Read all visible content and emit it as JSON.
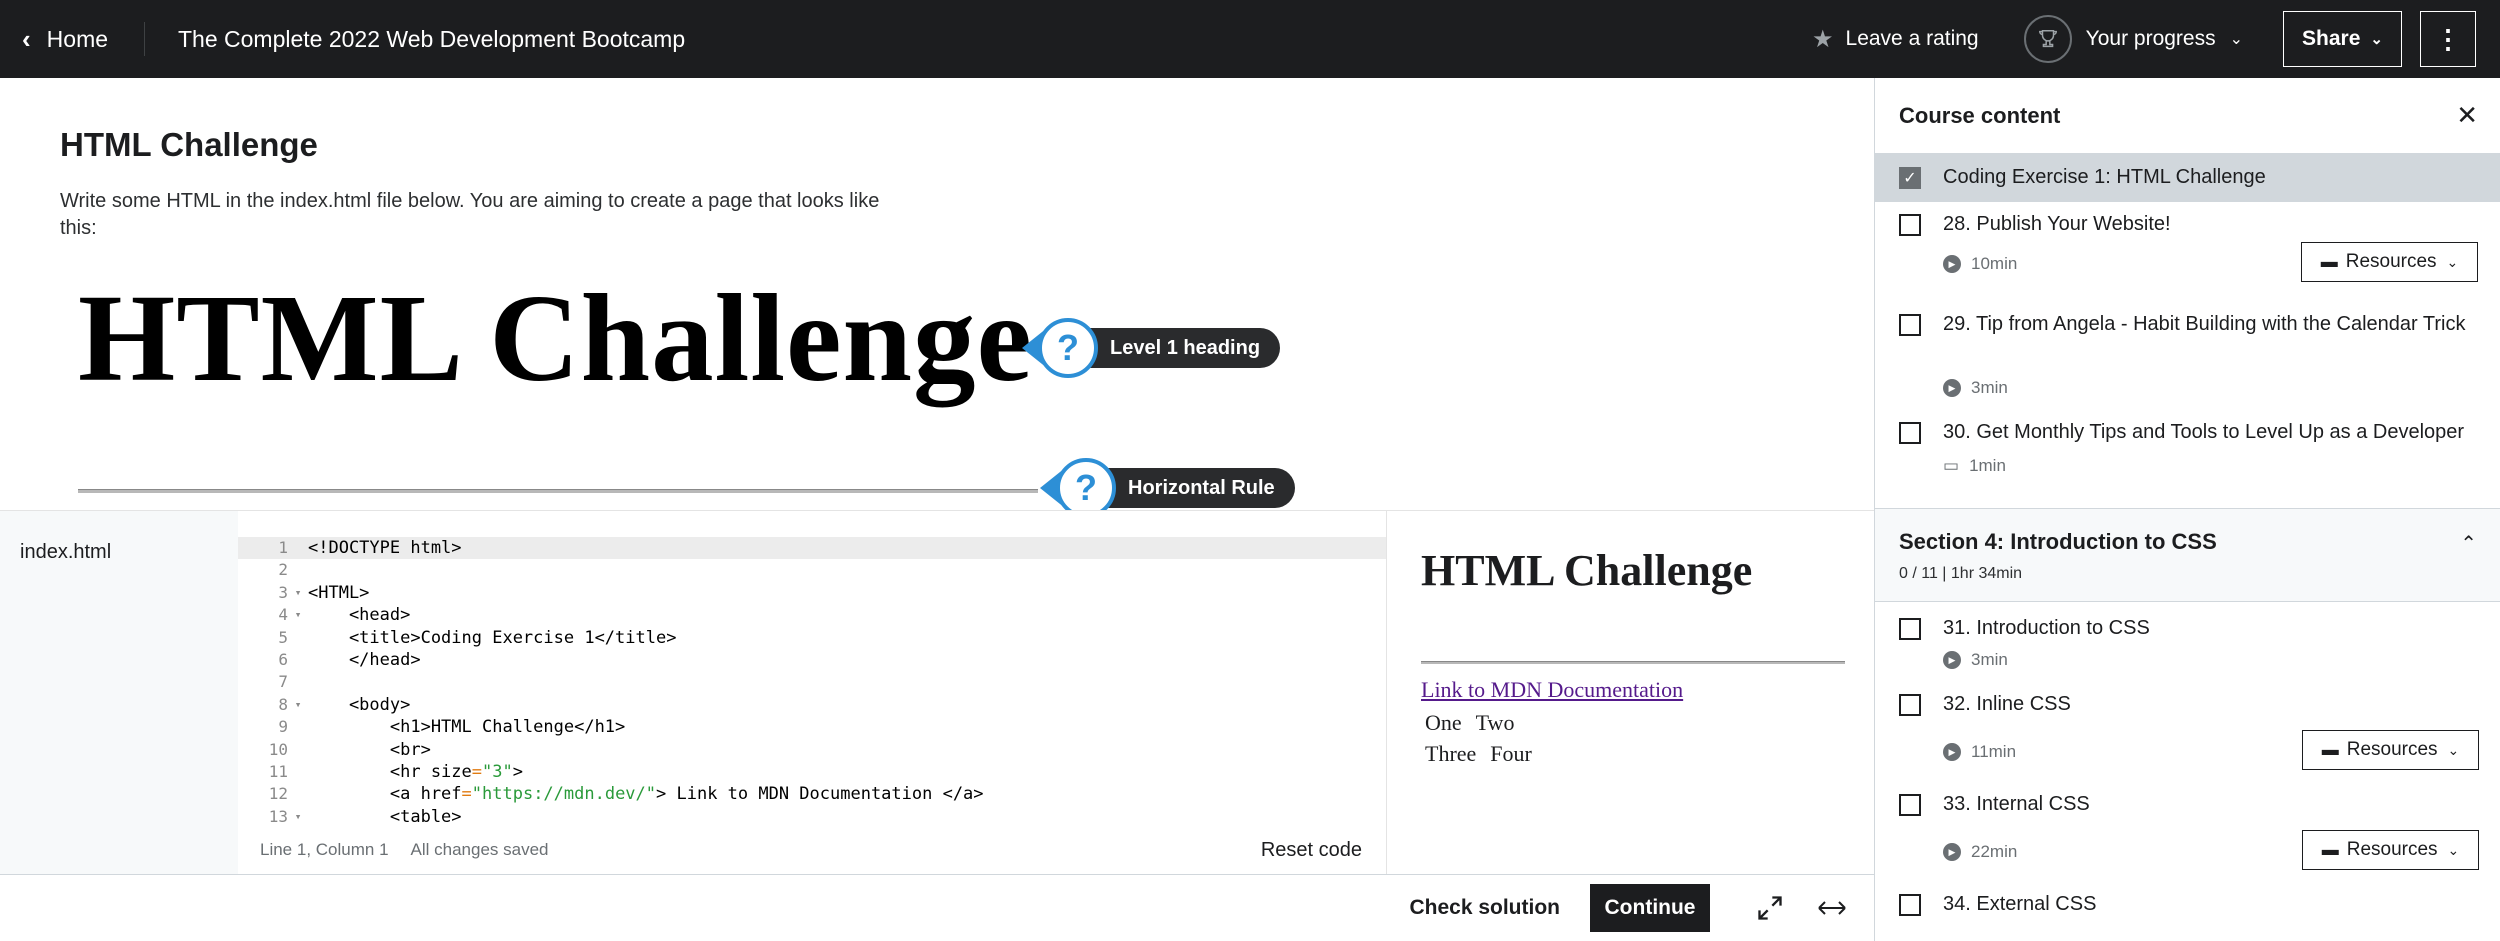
{
  "topbar": {
    "home_label": "Home",
    "course_title": "The Complete 2022 Web Development Bootcamp",
    "rating_label": "Leave a rating",
    "progress_label": "Your progress",
    "share_label": "Share"
  },
  "challenge": {
    "title": "HTML Challenge",
    "description": "Write some HTML in the index.html file below. You are aiming to create a page that looks like this:",
    "example_h1": "HTML Challenge",
    "callout_h1": "Level 1 heading",
    "callout_hr": "Horizontal Rule"
  },
  "editor": {
    "file_name": "index.html",
    "lines": [
      {
        "n": "1",
        "fold": "",
        "code": "<!DOCTYPE html>"
      },
      {
        "n": "2",
        "fold": "",
        "code": ""
      },
      {
        "n": "3",
        "fold": "▾",
        "code": "<HTML>"
      },
      {
        "n": "4",
        "fold": "▾",
        "code": "    <head>"
      },
      {
        "n": "5",
        "fold": "",
        "code": "    <title>Coding Exercise 1</title>"
      },
      {
        "n": "6",
        "fold": "",
        "code": "    </head>"
      },
      {
        "n": "7",
        "fold": "",
        "code": ""
      },
      {
        "n": "8",
        "fold": "▾",
        "code": "    <body>"
      },
      {
        "n": "9",
        "fold": "",
        "code": "        <h1>HTML Challenge</h1>"
      },
      {
        "n": "10",
        "fold": "",
        "code": "        <br>"
      },
      {
        "n": "11",
        "fold": "",
        "code": "        <hr size=\"3\">"
      },
      {
        "n": "12",
        "fold": "",
        "code": "        <a href=\"https://mdn.dev/\"> Link to MDN Documentation </a>"
      },
      {
        "n": "13",
        "fold": "▾",
        "code": "        <table>"
      }
    ],
    "cursor_position": "Line 1, Column 1",
    "save_status": "All changes saved",
    "reset_label": "Reset code"
  },
  "preview": {
    "h1": "HTML Challenge",
    "link": "Link to MDN Documentation",
    "row1": [
      "One",
      "Two"
    ],
    "row2": [
      "Three",
      "Four"
    ]
  },
  "footer": {
    "check_label": "Check solution",
    "continue_label": "Continue"
  },
  "sidebar": {
    "title": "Course content",
    "resources_label": "Resources",
    "items_top": [
      {
        "label": "Coding Exercise 1: HTML Challenge"
      },
      {
        "label": "28. Publish Your Website!",
        "duration": "10min"
      },
      {
        "label": "29. Tip from Angela - Habit Building with the Calendar Trick",
        "duration": "3min"
      },
      {
        "label": "30. Get Monthly Tips and Tools to Level Up as a Developer",
        "duration": "1min"
      }
    ],
    "section": {
      "title": "Section 4: Introduction to CSS",
      "meta": "0 / 11 | 1hr 34min"
    },
    "items_section": [
      {
        "label": "31. Introduction to CSS",
        "duration": "3min"
      },
      {
        "label": "32. Inline CSS",
        "duration": "11min"
      },
      {
        "label": "33. Internal CSS",
        "duration": "22min"
      },
      {
        "label": "34. External CSS"
      }
    ]
  },
  "colors": {
    "topbar_bg": "#1c1d1f",
    "callout_blue": "#2d8fd6",
    "current_item_bg": "#d1d7dc",
    "link_purple": "#551a8b",
    "code_string": "#2a9a3a"
  }
}
